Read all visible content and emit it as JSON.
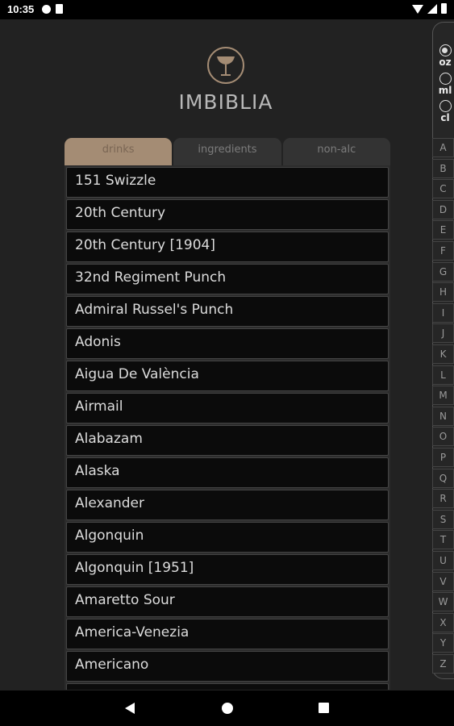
{
  "status_bar": {
    "time": "10:35",
    "left_icons": [
      "record-icon",
      "sd-card-icon"
    ],
    "right_icons": [
      "wifi-icon",
      "signal-icon",
      "battery-icon"
    ]
  },
  "app": {
    "name": "IMBIBLIA",
    "logo_icon": "cocktail-glass-icon",
    "accent_color": "#a48c74"
  },
  "tabs": [
    {
      "label": "drinks",
      "active": true
    },
    {
      "label": "ingredients",
      "active": false
    },
    {
      "label": "non-alc",
      "active": false
    }
  ],
  "drinks": [
    "151 Swizzle",
    "20th Century",
    "20th Century [1904]",
    "32nd Regiment Punch",
    "Admiral Russel's Punch",
    "Adonis",
    "Aigua De València",
    "Airmail",
    "Alabazam",
    "Alaska",
    "Alexander",
    "Algonquin",
    "Algonquin [1951]",
    "Amaretto Sour",
    "America-Venezia",
    "Americano",
    ""
  ],
  "units": [
    {
      "label": "oz",
      "selected": true
    },
    {
      "label": "ml",
      "selected": false
    },
    {
      "label": "cl",
      "selected": false
    }
  ],
  "alphabet": [
    "A",
    "B",
    "C",
    "D",
    "E",
    "F",
    "G",
    "H",
    "I",
    "J",
    "K",
    "L",
    "M",
    "N",
    "O",
    "P",
    "Q",
    "R",
    "S",
    "T",
    "U",
    "V",
    "W",
    "X",
    "Y",
    "Z"
  ],
  "nav_bar": [
    "back-icon",
    "home-icon",
    "recents-icon"
  ]
}
